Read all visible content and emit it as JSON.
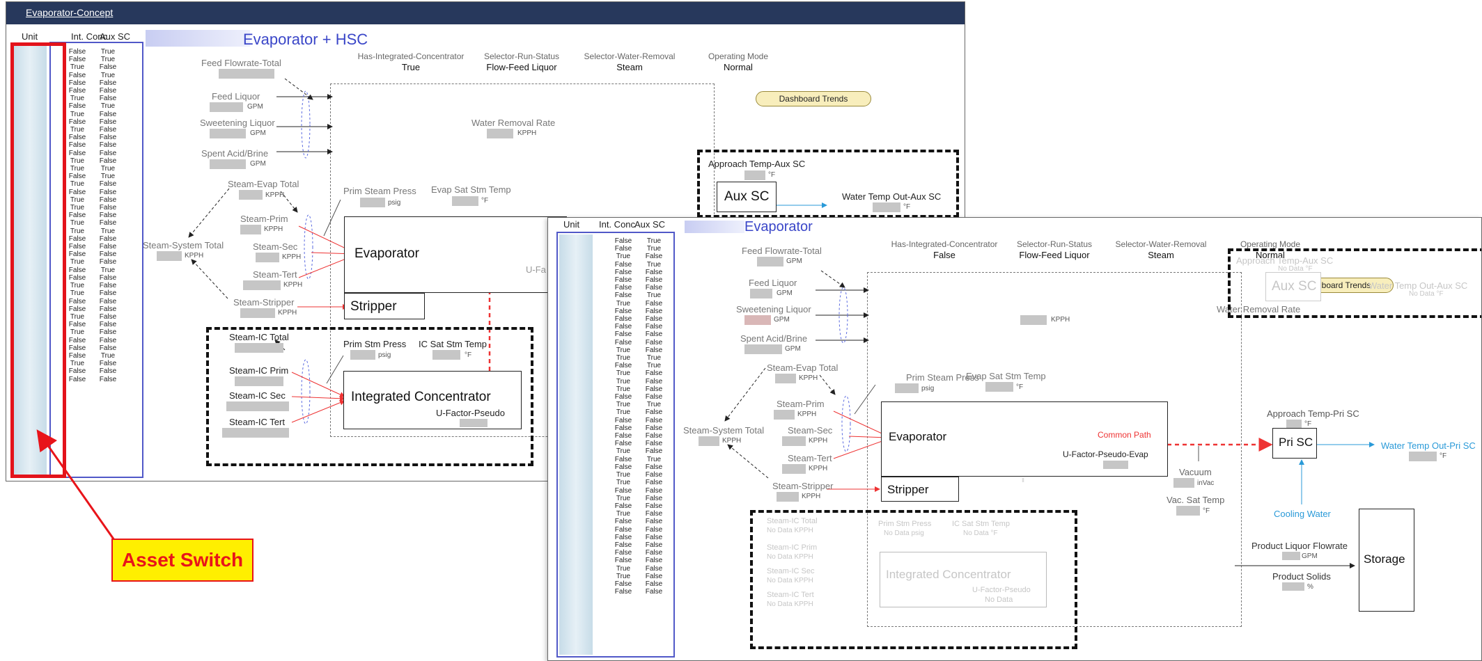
{
  "window1": {
    "title_link": "Evaporator-Concept",
    "dashboard_title": "Evaporator + HSC",
    "panel": {
      "col_unit": "Unit",
      "col_int_conc": "Int. Conc",
      "col_aux_sc": "Aux SC",
      "rows": [
        [
          "False",
          "True"
        ],
        [
          "False",
          "True"
        ],
        [
          "True",
          "False"
        ],
        [
          "False",
          "True"
        ],
        [
          "False",
          "False"
        ],
        [
          "False",
          "False"
        ],
        [
          "True",
          "False"
        ],
        [
          "False",
          "True"
        ],
        [
          "True",
          "False"
        ],
        [
          "False",
          "False"
        ],
        [
          "True",
          "False"
        ],
        [
          "False",
          "False"
        ],
        [
          "False",
          "False"
        ],
        [
          "False",
          "False"
        ],
        [
          "True",
          "False"
        ],
        [
          "True",
          "True"
        ],
        [
          "False",
          "True"
        ],
        [
          "True",
          "False"
        ],
        [
          "False",
          "False"
        ],
        [
          "True",
          "False"
        ],
        [
          "True",
          "False"
        ],
        [
          "False",
          "False"
        ],
        [
          "True",
          "False"
        ],
        [
          "True",
          "True"
        ],
        [
          "False",
          "False"
        ],
        [
          "False",
          "False"
        ],
        [
          "False",
          "False"
        ],
        [
          "True",
          "False"
        ],
        [
          "False",
          "True"
        ],
        [
          "False",
          "False"
        ],
        [
          "True",
          "False"
        ],
        [
          "True",
          "False"
        ],
        [
          "False",
          "False"
        ],
        [
          "False",
          "False"
        ],
        [
          "True",
          "False"
        ],
        [
          "False",
          "False"
        ],
        [
          "True",
          "False"
        ],
        [
          "False",
          "False"
        ],
        [
          "False",
          "False"
        ],
        [
          "False",
          "True"
        ],
        [
          "True",
          "False"
        ],
        [
          "False",
          "False"
        ],
        [
          "False",
          "False"
        ]
      ]
    },
    "header": {
      "has_ic_label": "Has-Integrated-Concentrator",
      "has_ic_value": "True",
      "run_status_label": "Selector-Run-Status",
      "run_status_value": "Flow-Feed Liquor",
      "water_removal_label": "Selector-Water-Removal",
      "water_removal_value": "Steam",
      "op_mode_label": "Operating Mode",
      "op_mode_value": "Normal"
    },
    "dashboard_trends": "Dashboard Trends",
    "labels": {
      "feed_flowrate_total": "Feed Flowrate-Total",
      "feed_liquor": "Feed Liquor",
      "sweetening_liquor": "Sweetening Liquor",
      "spent_acid": "Spent Acid/Brine",
      "water_removal_rate": "Water Removal Rate",
      "steam_evap_total": "Steam-Evap Total",
      "prim_steam_press": "Prim Steam Press",
      "evap_sat_stm_temp": "Evap Sat Stm Temp",
      "steam_prim": "Steam-Prim",
      "steam_sec": "Steam-Sec",
      "steam_tert": "Steam-Tert",
      "steam_system_total": "Steam-System Total",
      "steam_stripper": "Steam-Stripper",
      "steam_ic_total": "Steam-IC Total",
      "prim_stm_press": "Prim Stm Press",
      "ic_sat_stm_temp": "IC Sat Stm Temp",
      "steam_ic_prim": "Steam-IC Prim",
      "steam_ic_sec": "Steam-IC Sec",
      "steam_ic_tert": "Steam-IC Tert",
      "approach_temp_aux": "Approach Temp-Aux SC",
      "water_temp_out_aux": "Water Temp Out-Aux SC",
      "u_factor_pseudo": "U-Factor-Pseudo",
      "u_fa_clip": "U-Fa"
    },
    "units": {
      "gpm": "GPM",
      "kpph": "KPPH",
      "psig": "psig",
      "degf": "°F"
    },
    "boxes": {
      "evaporator": "Evaporator",
      "stripper": "Stripper",
      "integrated_concentrator": "Integrated Concentrator",
      "aux_sc": "Aux SC"
    }
  },
  "window2": {
    "dashboard_title": "Evaporator",
    "panel": {
      "col_unit": "Unit",
      "col_int_conc": "Int. Conc",
      "col_aux_sc": "Aux SC",
      "rows": [
        [
          "False",
          "True"
        ],
        [
          "False",
          "True"
        ],
        [
          "True",
          "False"
        ],
        [
          "False",
          "True"
        ],
        [
          "False",
          "False"
        ],
        [
          "False",
          "False"
        ],
        [
          "False",
          "False"
        ],
        [
          "False",
          "True"
        ],
        [
          "True",
          "False"
        ],
        [
          "False",
          "False"
        ],
        [
          "False",
          "False"
        ],
        [
          "False",
          "False"
        ],
        [
          "False",
          "False"
        ],
        [
          "False",
          "False"
        ],
        [
          "True",
          "False"
        ],
        [
          "True",
          "True"
        ],
        [
          "False",
          "True"
        ],
        [
          "True",
          "False"
        ],
        [
          "True",
          "False"
        ],
        [
          "True",
          "False"
        ],
        [
          "False",
          "False"
        ],
        [
          "True",
          "True"
        ],
        [
          "True",
          "False"
        ],
        [
          "False",
          "False"
        ],
        [
          "False",
          "False"
        ],
        [
          "False",
          "False"
        ],
        [
          "False",
          "False"
        ],
        [
          "True",
          "False"
        ],
        [
          "False",
          "True"
        ],
        [
          "False",
          "False"
        ],
        [
          "True",
          "False"
        ],
        [
          "True",
          "False"
        ],
        [
          "False",
          "False"
        ],
        [
          "True",
          "False"
        ],
        [
          "False",
          "False"
        ],
        [
          "True",
          "False"
        ],
        [
          "False",
          "False"
        ],
        [
          "False",
          "False"
        ],
        [
          "False",
          "False"
        ],
        [
          "False",
          "False"
        ],
        [
          "False",
          "False"
        ],
        [
          "False",
          "False"
        ],
        [
          "True",
          "False"
        ],
        [
          "True",
          "False"
        ],
        [
          "False",
          "False"
        ],
        [
          "False",
          "False"
        ]
      ]
    },
    "header": {
      "has_ic_label": "Has-Integrated-Concentrator",
      "has_ic_value": "False",
      "run_status_label": "Selector-Run-Status",
      "run_status_value": "Flow-Feed Liquor",
      "water_removal_label": "Selector-Water-Removal",
      "water_removal_value": "Steam",
      "op_mode_label": "Operating Mode",
      "op_mode_value": "Normal"
    },
    "dashboard_trends": "Dashboard Trends",
    "labels": {
      "feed_flowrate_total": "Feed Flowrate-Total",
      "feed_liquor": "Feed Liquor",
      "sweetening_liquor": "Sweetening Liquor",
      "spent_acid": "Spent Acid/Brine",
      "water_removal_rate": "Water Removal Rate",
      "steam_evap_total": "Steam-Evap Total",
      "prim_steam_press": "Prim Steam Press",
      "evap_sat_stm_temp": "Evap Sat Stm Temp",
      "steam_prim": "Steam-Prim",
      "steam_sec": "Steam-Sec",
      "steam_tert": "Steam-Tert",
      "steam_system_total": "Steam-System Total",
      "steam_stripper": "Steam-Stripper",
      "common_path": "Common Path",
      "u_factor_pseudo_evap": "U-Factor-Pseudo-Evap",
      "vacuum": "Vacuum",
      "vac_sat_temp": "Vac. Sat Temp",
      "approach_temp_aux": "Approach Temp-Aux SC",
      "water_temp_out_aux": "Water Temp Out-Aux SC",
      "approach_temp_pri": "Approach Temp-Pri SC",
      "water_temp_out_pri": "Water Temp Out-Pri SC",
      "cooling_water": "Cooling Water",
      "product_liquor_flowrate": "Product Liquor Flowrate",
      "product_solids": "Product Solids",
      "steam_ic_total": "Steam-IC Total",
      "steam_ic_prim": "Steam-IC Prim",
      "steam_ic_sec": "Steam-IC Sec",
      "steam_ic_tert": "Steam-IC Tert",
      "prim_stm_press": "Prim Stm Press",
      "ic_sat_stm_temp": "IC Sat Stm Temp",
      "u_factor_pseudo": "U-Factor-Pseudo",
      "no_data": "No Data"
    },
    "units": {
      "gpm": "GPM",
      "kpph": "KPPH",
      "psig": "psig",
      "degf": "°F",
      "invac": "inVac",
      "pct": "%",
      "no_data_degf": "No Data °F",
      "no_data_kpph": "No Data KPPH",
      "no_data_psig": "No Data psig"
    },
    "boxes": {
      "evaporator": "Evaporator",
      "stripper": "Stripper",
      "aux_sc": "Aux SC",
      "pri_sc": "Pri SC",
      "storage": "Storage",
      "integrated_concentrator": "Integrated Concentrator"
    }
  },
  "callout": {
    "label": "Asset Switch",
    "color": "#e8141a",
    "fill": "#ffef00"
  }
}
